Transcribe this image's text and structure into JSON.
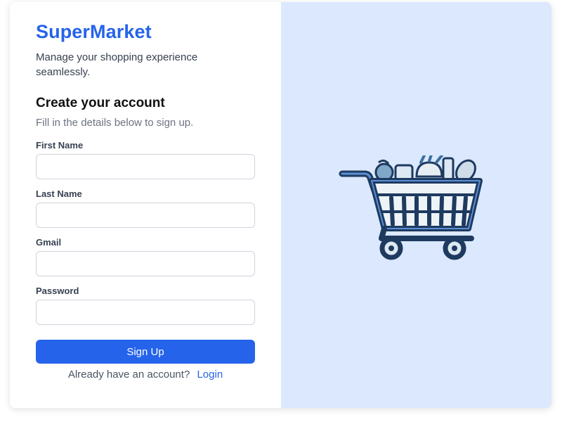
{
  "brand": {
    "name": "SuperMarket",
    "tagline": "Manage your shopping experience seamlessly."
  },
  "form": {
    "heading": "Create your account",
    "subheading": "Fill in the details below to sign up.",
    "fields": [
      {
        "label": "First Name",
        "value": "",
        "placeholder": ""
      },
      {
        "label": "Last Name",
        "value": "",
        "placeholder": ""
      },
      {
        "label": "Gmail",
        "value": "",
        "placeholder": ""
      },
      {
        "label": "Password",
        "value": "",
        "placeholder": ""
      }
    ],
    "submit_label": "Sign Up",
    "login_prompt": "Already have an account?",
    "login_label": "Login"
  },
  "illustration": {
    "icon": "shopping-cart-icon"
  },
  "colors": {
    "accent": "#2563eb",
    "panel_background": "#dbe8fe",
    "cart_outline": "#1e3a5f"
  }
}
